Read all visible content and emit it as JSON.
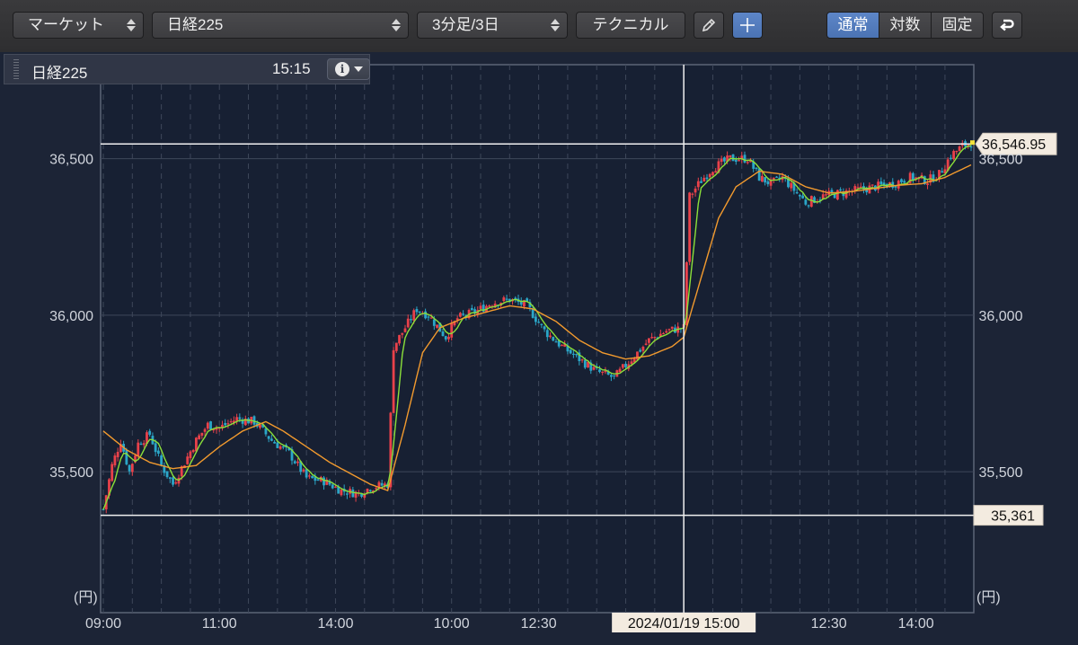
{
  "toolbar": {
    "market_select": "マーケット",
    "symbol_select": "日経225",
    "interval_select": "3分足/3日",
    "technical_button": "テクニカル",
    "pencil_icon": "pencil-icon",
    "crosshair_icon": "crosshair-icon",
    "scale_modes": [
      "通常",
      "対数",
      "固定"
    ],
    "active_scale_mode": "通常",
    "undo_icon": "undo-icon",
    "active_color": "#5a82c4"
  },
  "info_bar": {
    "symbol": "日経225",
    "time": "15:15",
    "info_icon": "info-icon"
  },
  "chart": {
    "unit_left": "(円)",
    "unit_right": "(円)",
    "high_label": "36,546.95",
    "low_label": "35,361",
    "crosshair_label": "2024/01/19 15:00",
    "colors": {
      "background": "#1c2436",
      "up": "#e8414a",
      "down": "#2ba6c8",
      "ma_short": "#8be03a",
      "ma_long": "#f29a2e"
    }
  },
  "chart_data": {
    "type": "candlestick",
    "ylim": [
      35050,
      36800
    ],
    "y_ticks": [
      {
        "value": 35500,
        "label": "35,500"
      },
      {
        "value": 36000,
        "label": "36,000"
      },
      {
        "value": 36500,
        "label": "36,500"
      }
    ],
    "x_ticks": [
      {
        "slot": 0,
        "label": "09:00"
      },
      {
        "slot": 40,
        "label": "11:00"
      },
      {
        "slot": 80,
        "label": "14:00"
      },
      {
        "slot": 120,
        "label": "10:00"
      },
      {
        "slot": 150,
        "label": "12:30"
      },
      {
        "slot": 250,
        "label": "12:30"
      },
      {
        "slot": 280,
        "label": "14:00"
      }
    ],
    "total_slots": 300,
    "crosshair_slot": 200,
    "high_line": 36546.95,
    "low_line": 35361,
    "price_path": [
      [
        0,
        35380
      ],
      [
        3,
        35520
      ],
      [
        6,
        35600
      ],
      [
        9,
        35500
      ],
      [
        12,
        35590
      ],
      [
        16,
        35620
      ],
      [
        20,
        35520
      ],
      [
        24,
        35460
      ],
      [
        28,
        35530
      ],
      [
        32,
        35600
      ],
      [
        36,
        35650
      ],
      [
        40,
        35640
      ],
      [
        46,
        35670
      ],
      [
        52,
        35660
      ],
      [
        58,
        35600
      ],
      [
        64,
        35560
      ],
      [
        70,
        35480
      ],
      [
        76,
        35470
      ],
      [
        82,
        35440
      ],
      [
        88,
        35430
      ],
      [
        92,
        35450
      ],
      [
        98,
        35460
      ],
      [
        100,
        35900
      ],
      [
        104,
        35960
      ],
      [
        108,
        36020
      ],
      [
        112,
        36000
      ],
      [
        118,
        35930
      ],
      [
        122,
        35990
      ],
      [
        128,
        36010
      ],
      [
        134,
        36040
      ],
      [
        140,
        36050
      ],
      [
        146,
        36030
      ],
      [
        152,
        35950
      ],
      [
        158,
        35900
      ],
      [
        164,
        35860
      ],
      [
        170,
        35820
      ],
      [
        176,
        35800
      ],
      [
        182,
        35860
      ],
      [
        188,
        35920
      ],
      [
        194,
        35950
      ],
      [
        200,
        35960
      ],
      [
        202,
        36380
      ],
      [
        206,
        36430
      ],
      [
        210,
        36470
      ],
      [
        216,
        36500
      ],
      [
        222,
        36500
      ],
      [
        226,
        36440
      ],
      [
        230,
        36420
      ],
      [
        234,
        36440
      ],
      [
        238,
        36400
      ],
      [
        242,
        36360
      ],
      [
        248,
        36380
      ],
      [
        254,
        36390
      ],
      [
        260,
        36400
      ],
      [
        266,
        36410
      ],
      [
        272,
        36420
      ],
      [
        278,
        36440
      ],
      [
        284,
        36430
      ],
      [
        288,
        36450
      ],
      [
        292,
        36510
      ],
      [
        296,
        36540
      ],
      [
        299,
        36550
      ]
    ],
    "ma_long_path": [
      [
        0,
        35630
      ],
      [
        8,
        35570
      ],
      [
        16,
        35530
      ],
      [
        24,
        35510
      ],
      [
        32,
        35520
      ],
      [
        40,
        35580
      ],
      [
        48,
        35630
      ],
      [
        56,
        35660
      ],
      [
        62,
        35630
      ],
      [
        70,
        35580
      ],
      [
        78,
        35530
      ],
      [
        86,
        35490
      ],
      [
        92,
        35460
      ],
      [
        98,
        35440
      ],
      [
        104,
        35650
      ],
      [
        110,
        35880
      ],
      [
        116,
        35960
      ],
      [
        124,
        35990
      ],
      [
        132,
        36010
      ],
      [
        140,
        36030
      ],
      [
        148,
        36020
      ],
      [
        156,
        35980
      ],
      [
        164,
        35920
      ],
      [
        172,
        35880
      ],
      [
        180,
        35860
      ],
      [
        188,
        35870
      ],
      [
        196,
        35900
      ],
      [
        200,
        35930
      ],
      [
        206,
        36120
      ],
      [
        212,
        36310
      ],
      [
        218,
        36410
      ],
      [
        226,
        36460
      ],
      [
        234,
        36450
      ],
      [
        242,
        36410
      ],
      [
        250,
        36390
      ],
      [
        258,
        36395
      ],
      [
        266,
        36405
      ],
      [
        274,
        36415
      ],
      [
        282,
        36420
      ],
      [
        290,
        36440
      ],
      [
        299,
        36480
      ]
    ]
  }
}
